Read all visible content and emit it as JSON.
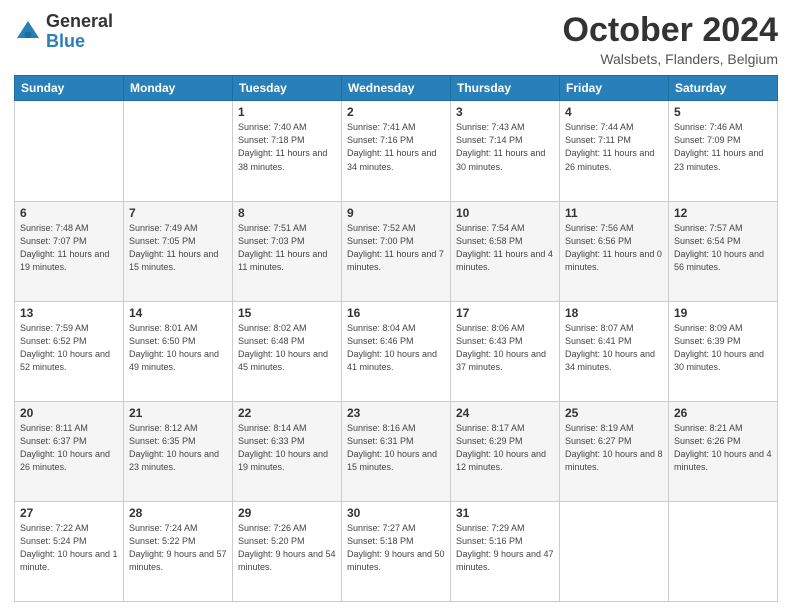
{
  "logo": {
    "general": "General",
    "blue": "Blue"
  },
  "header": {
    "title": "October 2024",
    "subtitle": "Walsbets, Flanders, Belgium"
  },
  "days_of_week": [
    "Sunday",
    "Monday",
    "Tuesday",
    "Wednesday",
    "Thursday",
    "Friday",
    "Saturday"
  ],
  "weeks": [
    [
      {
        "day": "",
        "detail": ""
      },
      {
        "day": "",
        "detail": ""
      },
      {
        "day": "1",
        "detail": "Sunrise: 7:40 AM\nSunset: 7:18 PM\nDaylight: 11 hours\nand 38 minutes."
      },
      {
        "day": "2",
        "detail": "Sunrise: 7:41 AM\nSunset: 7:16 PM\nDaylight: 11 hours\nand 34 minutes."
      },
      {
        "day": "3",
        "detail": "Sunrise: 7:43 AM\nSunset: 7:14 PM\nDaylight: 11 hours\nand 30 minutes."
      },
      {
        "day": "4",
        "detail": "Sunrise: 7:44 AM\nSunset: 7:11 PM\nDaylight: 11 hours\nand 26 minutes."
      },
      {
        "day": "5",
        "detail": "Sunrise: 7:46 AM\nSunset: 7:09 PM\nDaylight: 11 hours\nand 23 minutes."
      }
    ],
    [
      {
        "day": "6",
        "detail": "Sunrise: 7:48 AM\nSunset: 7:07 PM\nDaylight: 11 hours\nand 19 minutes."
      },
      {
        "day": "7",
        "detail": "Sunrise: 7:49 AM\nSunset: 7:05 PM\nDaylight: 11 hours\nand 15 minutes."
      },
      {
        "day": "8",
        "detail": "Sunrise: 7:51 AM\nSunset: 7:03 PM\nDaylight: 11 hours\nand 11 minutes."
      },
      {
        "day": "9",
        "detail": "Sunrise: 7:52 AM\nSunset: 7:00 PM\nDaylight: 11 hours\nand 7 minutes."
      },
      {
        "day": "10",
        "detail": "Sunrise: 7:54 AM\nSunset: 6:58 PM\nDaylight: 11 hours\nand 4 minutes."
      },
      {
        "day": "11",
        "detail": "Sunrise: 7:56 AM\nSunset: 6:56 PM\nDaylight: 11 hours\nand 0 minutes."
      },
      {
        "day": "12",
        "detail": "Sunrise: 7:57 AM\nSunset: 6:54 PM\nDaylight: 10 hours\nand 56 minutes."
      }
    ],
    [
      {
        "day": "13",
        "detail": "Sunrise: 7:59 AM\nSunset: 6:52 PM\nDaylight: 10 hours\nand 52 minutes."
      },
      {
        "day": "14",
        "detail": "Sunrise: 8:01 AM\nSunset: 6:50 PM\nDaylight: 10 hours\nand 49 minutes."
      },
      {
        "day": "15",
        "detail": "Sunrise: 8:02 AM\nSunset: 6:48 PM\nDaylight: 10 hours\nand 45 minutes."
      },
      {
        "day": "16",
        "detail": "Sunrise: 8:04 AM\nSunset: 6:46 PM\nDaylight: 10 hours\nand 41 minutes."
      },
      {
        "day": "17",
        "detail": "Sunrise: 8:06 AM\nSunset: 6:43 PM\nDaylight: 10 hours\nand 37 minutes."
      },
      {
        "day": "18",
        "detail": "Sunrise: 8:07 AM\nSunset: 6:41 PM\nDaylight: 10 hours\nand 34 minutes."
      },
      {
        "day": "19",
        "detail": "Sunrise: 8:09 AM\nSunset: 6:39 PM\nDaylight: 10 hours\nand 30 minutes."
      }
    ],
    [
      {
        "day": "20",
        "detail": "Sunrise: 8:11 AM\nSunset: 6:37 PM\nDaylight: 10 hours\nand 26 minutes."
      },
      {
        "day": "21",
        "detail": "Sunrise: 8:12 AM\nSunset: 6:35 PM\nDaylight: 10 hours\nand 23 minutes."
      },
      {
        "day": "22",
        "detail": "Sunrise: 8:14 AM\nSunset: 6:33 PM\nDaylight: 10 hours\nand 19 minutes."
      },
      {
        "day": "23",
        "detail": "Sunrise: 8:16 AM\nSunset: 6:31 PM\nDaylight: 10 hours\nand 15 minutes."
      },
      {
        "day": "24",
        "detail": "Sunrise: 8:17 AM\nSunset: 6:29 PM\nDaylight: 10 hours\nand 12 minutes."
      },
      {
        "day": "25",
        "detail": "Sunrise: 8:19 AM\nSunset: 6:27 PM\nDaylight: 10 hours\nand 8 minutes."
      },
      {
        "day": "26",
        "detail": "Sunrise: 8:21 AM\nSunset: 6:26 PM\nDaylight: 10 hours\nand 4 minutes."
      }
    ],
    [
      {
        "day": "27",
        "detail": "Sunrise: 7:22 AM\nSunset: 5:24 PM\nDaylight: 10 hours\nand 1 minute."
      },
      {
        "day": "28",
        "detail": "Sunrise: 7:24 AM\nSunset: 5:22 PM\nDaylight: 9 hours\nand 57 minutes."
      },
      {
        "day": "29",
        "detail": "Sunrise: 7:26 AM\nSunset: 5:20 PM\nDaylight: 9 hours\nand 54 minutes."
      },
      {
        "day": "30",
        "detail": "Sunrise: 7:27 AM\nSunset: 5:18 PM\nDaylight: 9 hours\nand 50 minutes."
      },
      {
        "day": "31",
        "detail": "Sunrise: 7:29 AM\nSunset: 5:16 PM\nDaylight: 9 hours\nand 47 minutes."
      },
      {
        "day": "",
        "detail": ""
      },
      {
        "day": "",
        "detail": ""
      }
    ]
  ]
}
